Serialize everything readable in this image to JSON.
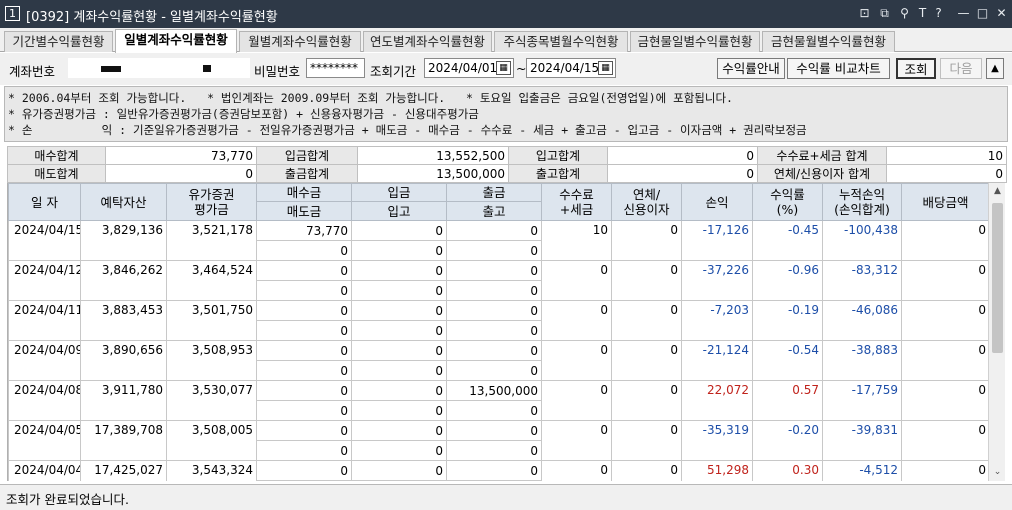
{
  "window": {
    "icon": "1",
    "title": "[0392] 계좌수익률현황 - 일별계좌수익률현황",
    "buttons": [
      "⊡",
      "⧉",
      "⚲",
      "T",
      "?",
      "—",
      "□",
      "✕"
    ]
  },
  "tabs": [
    {
      "label": "기간별수익률현황"
    },
    {
      "label": "일별계좌수익률현황"
    },
    {
      "label": "월별계좌수익률현황"
    },
    {
      "label": "연도별계좌수익률현황"
    },
    {
      "label": "주식종목별월수익현황"
    },
    {
      "label": "금현물일별수익률현황"
    },
    {
      "label": "금현물월별수익률현황"
    }
  ],
  "query": {
    "account_label": "계좌번호",
    "password_label": "비밀번호",
    "password_value": "********",
    "period_label": "조회기간",
    "date_from": "2024/04/01",
    "date_sep": "~",
    "date_to": "2024/04/15",
    "btn_guide": "수익률안내",
    "btn_compare": "수익률 비교차트",
    "btn_search": "조회",
    "btn_next": "다음",
    "btn_up": "▲"
  },
  "notes": {
    "line1": "* 2006.04부터 조회 가능합니다.   * 법인계좌는 2009.09부터 조회 가능합니다.   * 토요일 입출금은 금요일(전영업일)에 포함됩니다.",
    "line2": "* 유가증권평가금 : 일반유가증권평가금(증권담보포함) + 신용융자평가금 - 신용대주평가금",
    "line3": "* 손          익 : 기준일유가증권평가금 - 전일유가증권평가금 + 매도금 - 매수금 - 수수료 - 세금 + 출고금 - 입고금 - 이자금액 + 권리락보정금"
  },
  "summary": {
    "buy_total_label": "매수합계",
    "buy_total": "73,770",
    "deposit_total_label": "입금합계",
    "deposit_total": "13,552,500",
    "in_total_label": "입고합계",
    "in_total": "0",
    "fee_tax_total_label": "수수료+세금 합계",
    "fee_tax_total": "10",
    "sell_total_label": "매도합계",
    "sell_total": "0",
    "withdraw_total_label": "출금합계",
    "withdraw_total": "13,500,000",
    "out_total_label": "출고합계",
    "out_total": "0",
    "interest_total_label": "연체/신용이자 합계",
    "interest_total": "0"
  },
  "grid": {
    "headers": {
      "date": "일 자",
      "deposit_assets": "예탁자산",
      "securities_eval_1": "유가증권",
      "securities_eval_2": "평가금",
      "buy": "매수금",
      "sell": "매도금",
      "deposit": "입금",
      "in": "입고",
      "withdraw": "출금",
      "out": "출고",
      "fee_tax_1": "수수료",
      "fee_tax_2": "+세금",
      "interest_1": "연체/",
      "interest_2": "신용이자",
      "profit": "손익",
      "return_1": "수익률",
      "return_2": "(%)",
      "cum_profit_1": "누적손익",
      "cum_profit_2": "(손익합계)",
      "dividend": "배당금액"
    },
    "rows": [
      {
        "date": "2024/04/15",
        "deposit_assets": "3,829,136",
        "securities_eval": "3,521,178",
        "buy": "73,770",
        "sell": "0",
        "deposit": "0",
        "in": "0",
        "withdraw": "0",
        "out": "0",
        "fee_tax": "10",
        "interest": "0",
        "profit": "-17,126",
        "return": "-0.45",
        "cum_profit": "-100,438",
        "dividend": "0"
      },
      {
        "date": "2024/04/12",
        "deposit_assets": "3,846,262",
        "securities_eval": "3,464,524",
        "buy": "0",
        "sell": "0",
        "deposit": "0",
        "in": "0",
        "withdraw": "0",
        "out": "0",
        "fee_tax": "0",
        "interest": "0",
        "profit": "-37,226",
        "return": "-0.96",
        "cum_profit": "-83,312",
        "dividend": "0"
      },
      {
        "date": "2024/04/11",
        "deposit_assets": "3,883,453",
        "securities_eval": "3,501,750",
        "buy": "0",
        "sell": "0",
        "deposit": "0",
        "in": "0",
        "withdraw": "0",
        "out": "0",
        "fee_tax": "0",
        "interest": "0",
        "profit": "-7,203",
        "return": "-0.19",
        "cum_profit": "-46,086",
        "dividend": "0"
      },
      {
        "date": "2024/04/09",
        "deposit_assets": "3,890,656",
        "securities_eval": "3,508,953",
        "buy": "0",
        "sell": "0",
        "deposit": "0",
        "in": "0",
        "withdraw": "0",
        "out": "0",
        "fee_tax": "0",
        "interest": "0",
        "profit": "-21,124",
        "return": "-0.54",
        "cum_profit": "-38,883",
        "dividend": "0"
      },
      {
        "date": "2024/04/08",
        "deposit_assets": "3,911,780",
        "securities_eval": "3,530,077",
        "buy": "0",
        "sell": "0",
        "deposit": "0",
        "in": "0",
        "withdraw": "13,500,000",
        "out": "0",
        "fee_tax": "0",
        "interest": "0",
        "profit": "22,072",
        "return": "0.57",
        "cum_profit": "-17,759",
        "dividend": "0"
      },
      {
        "date": "2024/04/05",
        "deposit_assets": "17,389,708",
        "securities_eval": "3,508,005",
        "buy": "0",
        "sell": "0",
        "deposit": "0",
        "in": "0",
        "withdraw": "0",
        "out": "0",
        "fee_tax": "0",
        "interest": "0",
        "profit": "-35,319",
        "return": "-0.20",
        "cum_profit": "-39,831",
        "dividend": "0"
      },
      {
        "date": "2024/04/04",
        "deposit_assets": "17,425,027",
        "securities_eval": "3,543,324",
        "buy": "0",
        "sell": "0",
        "deposit": "0",
        "in": "0",
        "withdraw": "0",
        "out": "0",
        "fee_tax": "0",
        "interest": "0",
        "profit": "51,298",
        "return": "0.30",
        "cum_profit": "-4,512",
        "dividend": "0"
      }
    ]
  },
  "status": {
    "text": "조회가 완료되었습니다."
  },
  "colors": {
    "negative": "#1d4ea8",
    "positive": "#c0231c",
    "header_bg": "#dde5ee",
    "titlebar_bg": "#2e3947"
  }
}
